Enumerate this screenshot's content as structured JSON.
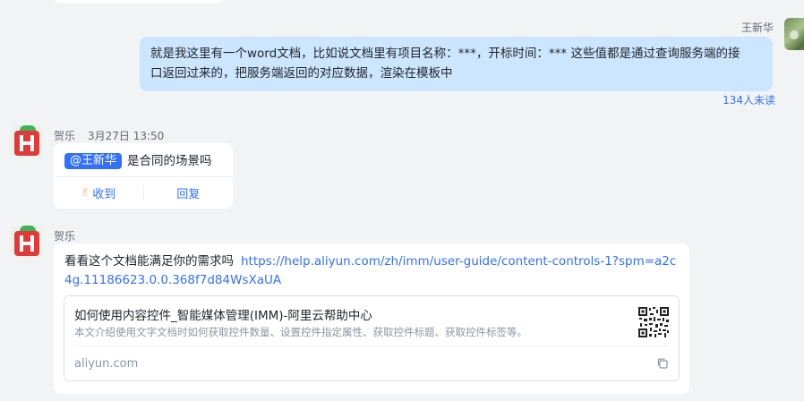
{
  "self_message": {
    "sender": "王新华",
    "text_lines": [
      "就是我这里有一个word文档，比如说文档里有项目名称：***，开标时间：***  这些值都是通过查询服务端的接",
      "口返回过来的，把服务端返回的对应数据，渲染在模板中"
    ],
    "unread": "134人未读"
  },
  "message1": {
    "sender": "贺乐",
    "time": "3月27日 13:50",
    "mention": "@王新华",
    "text": "是合同的场景吗",
    "actions": {
      "received": "收到",
      "reply": "回复"
    }
  },
  "message2": {
    "sender": "贺乐",
    "text": "看看这个文档能满足你的需求吗",
    "link": "https://help.aliyun.com/zh/imm/user-guide/content-controls-1?spm=a2c4g.11186623.0.0.368f7d84WsXaUA",
    "preview": {
      "title": "如何使用内容控件_智能媒体管理(IMM)-阿里云帮助中心",
      "description": "本文介绍使用文字文档时如何获取控件数量、设置控件指定属性、获取控件标题、获取控件标签等。",
      "domain": "aliyun.com"
    }
  },
  "colors": {
    "accent": "#3370ff",
    "self_bubble": "#cce6ff",
    "background": "#f2f3f5"
  }
}
